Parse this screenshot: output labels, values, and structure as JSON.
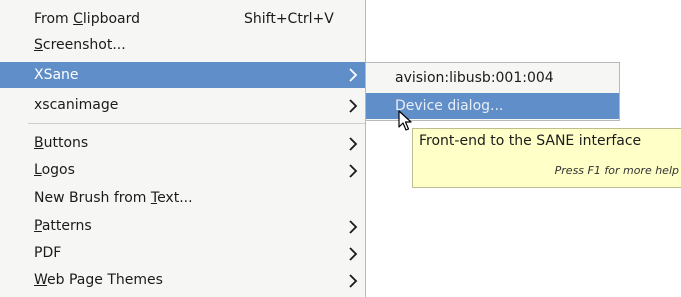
{
  "menu": {
    "items": [
      {
        "pre": "From ",
        "mnemonic": "C",
        "post": "lipboard",
        "accel": "Shift+Ctrl+V",
        "submenu": false
      },
      {
        "pre": "",
        "mnemonic": "S",
        "post": "creenshot...",
        "accel": "",
        "submenu": false
      },
      {
        "pre": "XSane",
        "mnemonic": "",
        "post": "",
        "accel": "",
        "submenu": true,
        "selected": true
      },
      {
        "pre": "xscanimage",
        "mnemonic": "",
        "post": "",
        "accel": "",
        "submenu": true
      },
      {
        "pre": "",
        "mnemonic": "B",
        "post": "uttons",
        "accel": "",
        "submenu": true
      },
      {
        "pre": "",
        "mnemonic": "L",
        "post": "ogos",
        "accel": "",
        "submenu": true
      },
      {
        "pre": "New Brush from ",
        "mnemonic": "T",
        "post": "ext...",
        "accel": "",
        "submenu": false
      },
      {
        "pre": "",
        "mnemonic": "P",
        "post": "atterns",
        "accel": "",
        "submenu": true
      },
      {
        "pre": "PDF",
        "mnemonic": "",
        "post": "",
        "accel": "",
        "submenu": true
      },
      {
        "pre": "",
        "mnemonic": "W",
        "post": "eb Page Themes",
        "accel": "",
        "submenu": true
      }
    ]
  },
  "submenu": {
    "items": [
      {
        "label": "avision:libusb:001:004"
      },
      {
        "label": "Device dialog...",
        "selected": true
      }
    ]
  },
  "tooltip": {
    "main": "Front-end to the SANE interface",
    "help": "Press F1 for more help"
  },
  "icons": {
    "submenu_arrow": "chevron-right-icon",
    "cursor": "mouse-pointer-icon"
  },
  "colors": {
    "selection": "#5f8ec8",
    "tooltip_bg": "#ffffc8",
    "menu_bg": "#f6f6f5"
  }
}
